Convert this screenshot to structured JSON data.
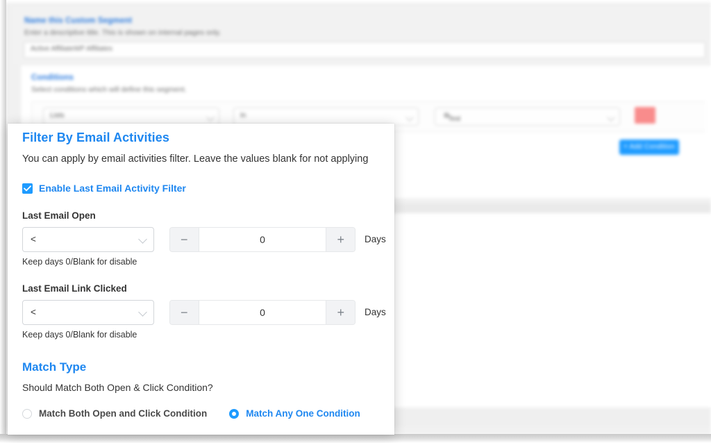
{
  "background": {
    "name_section": {
      "title": "Name this Custom Segment",
      "help": "Enter a descriptive title. This is shown on internal pages only.",
      "input_value": "Active AffiliateWP Affiliates"
    },
    "conditions_section": {
      "title": "Conditions",
      "help": "Select conditions which will define this segment.",
      "row": {
        "field_select": "Lists",
        "operator_select": "In",
        "value_chip": "Test",
        "delete_label": ""
      },
      "add_condition_label": "+ Add Condition"
    }
  },
  "panel": {
    "title": "Filter By Email Activities",
    "description": "You can apply by email activities filter. Leave the values blank for not applying",
    "enable_filter": {
      "label": "Enable Last Email Activity Filter",
      "checked": true
    },
    "fields": [
      {
        "label": "Last Email Open",
        "operator": "<",
        "value": "0",
        "unit": "Days",
        "hint": "Keep days 0/Blank for disable"
      },
      {
        "label": "Last Email Link Clicked",
        "operator": "<",
        "value": "0",
        "unit": "Days",
        "hint": "Keep days 0/Blank for disable"
      }
    ],
    "stepper": {
      "minus_label": "−",
      "plus_label": "+"
    },
    "match_type": {
      "title": "Match Type",
      "description": "Should Match Both Open & Click Condition?",
      "options": [
        {
          "label": "Match Both Open and Click Condition",
          "selected": false
        },
        {
          "label": "Match Any One Condition",
          "selected": true
        }
      ]
    }
  },
  "colors": {
    "accent_blue": "#1e87f0",
    "control_blue": "#1e9bff",
    "danger_red": "#f98c8c",
    "text_dark": "#333333",
    "page_grey": "#f1f1f1"
  }
}
